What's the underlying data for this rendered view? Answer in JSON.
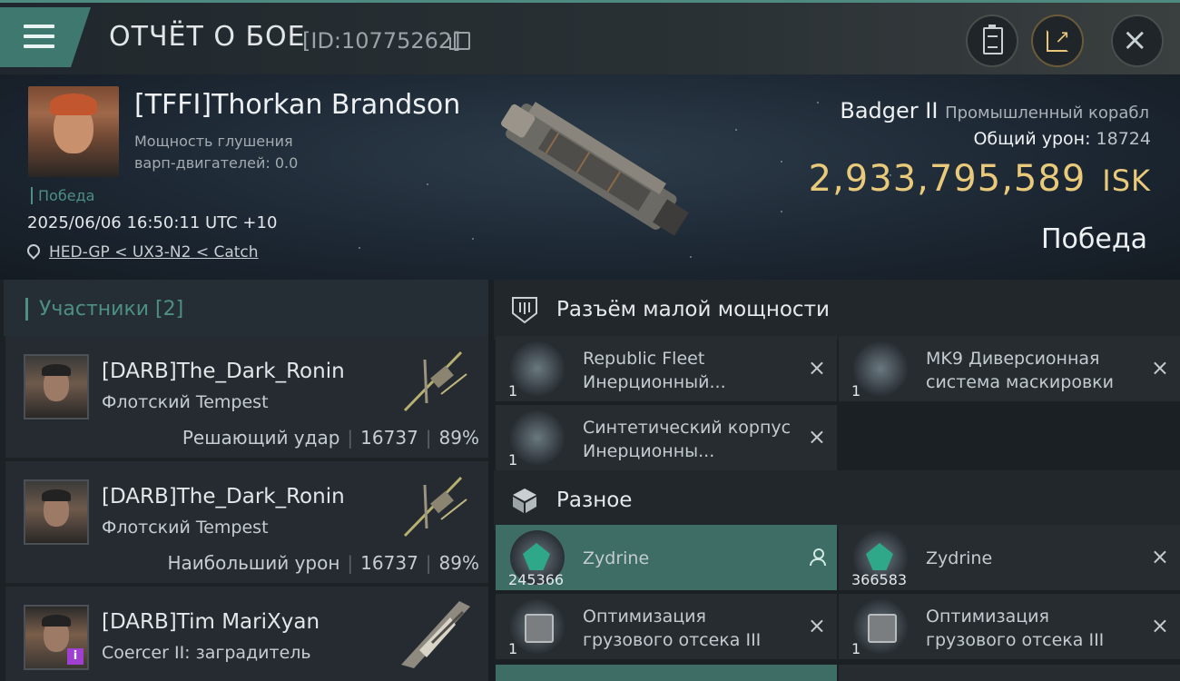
{
  "header": {
    "title": "ОТЧЁТ О БОЕ",
    "report_id": "[ID:10775262]"
  },
  "victim": {
    "name": "[TFFI]Thorkan Brandson",
    "warp_label": "Мощность глушения варп-двигателей: 0.0",
    "tag": "Победа",
    "datetime": "2025/06/06 16:50:11 UTC +10",
    "location": "HED-GP < UX3-N2 < Catch",
    "ship_name": "Badger II",
    "ship_class": "Промышленный корабл",
    "total_damage_label": "Общий урон:",
    "total_damage_value": "18724",
    "isk_value": "2,933,795,589",
    "isk_unit": "ISK",
    "result": "Победа"
  },
  "participants": {
    "heading": "Участники [2]",
    "cards": [
      {
        "name": "[DARB]The_Dark_Ronin",
        "ship": "Флотский Tempest",
        "role": "Решающий удар",
        "damage": "16737",
        "percent": "89%"
      },
      {
        "name": "[DARB]The_Dark_Ronin",
        "ship": "Флотский Tempest",
        "role": "Наибольший урон",
        "damage": "16737",
        "percent": "89%"
      },
      {
        "name": "[DARB]Tim MariXyan",
        "ship": "Coercer II: заградитель",
        "badge": "i"
      }
    ]
  },
  "low_slots": {
    "heading": "Разъём малой мощности",
    "items": [
      {
        "name": "Republic Fleet Инерционный...",
        "qty": "1"
      },
      {
        "name": "MK9 Диверсионная система маскировки",
        "qty": "1"
      },
      {
        "name": "Синтетический корпус Инерционны...",
        "qty": "1"
      }
    ]
  },
  "misc": {
    "heading": "Разное",
    "items": [
      {
        "name": "Zydrine",
        "qty": "245366"
      },
      {
        "name": "Zydrine",
        "qty": "366583"
      },
      {
        "name": "Оптимизация грузового отсека III",
        "qty": "1"
      },
      {
        "name": "Оптимизация грузового отсека III",
        "qty": "1"
      }
    ]
  },
  "icons": {
    "close": "×"
  }
}
